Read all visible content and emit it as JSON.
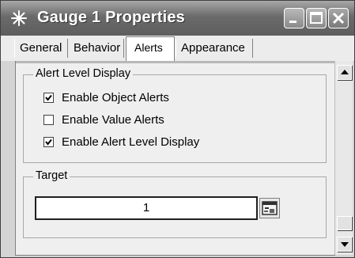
{
  "window": {
    "title": "Gauge 1 Properties",
    "app_icon": "sparkle-icon",
    "controls": {
      "minimize_icon": "minimize-icon",
      "maximize_icon": "maximize-icon",
      "close_icon": "close-icon"
    }
  },
  "tabs": [
    {
      "label": "General",
      "active": false
    },
    {
      "label": "Behavior",
      "active": false
    },
    {
      "label": "Alerts",
      "active": true
    },
    {
      "label": "Appearance",
      "active": false
    }
  ],
  "alert_level_display": {
    "legend": "Alert Level Display",
    "options": [
      {
        "label": "Enable Object Alerts",
        "checked": true
      },
      {
        "label": "Enable Value Alerts",
        "checked": false
      },
      {
        "label": "Enable Alert Level Display",
        "checked": true
      }
    ]
  },
  "target": {
    "legend": "Target",
    "value": "1",
    "browse_icon": "value-picker-icon"
  },
  "scrollbar": {
    "up_icon": "arrow-up-icon",
    "down_icon": "arrow-down-icon"
  }
}
